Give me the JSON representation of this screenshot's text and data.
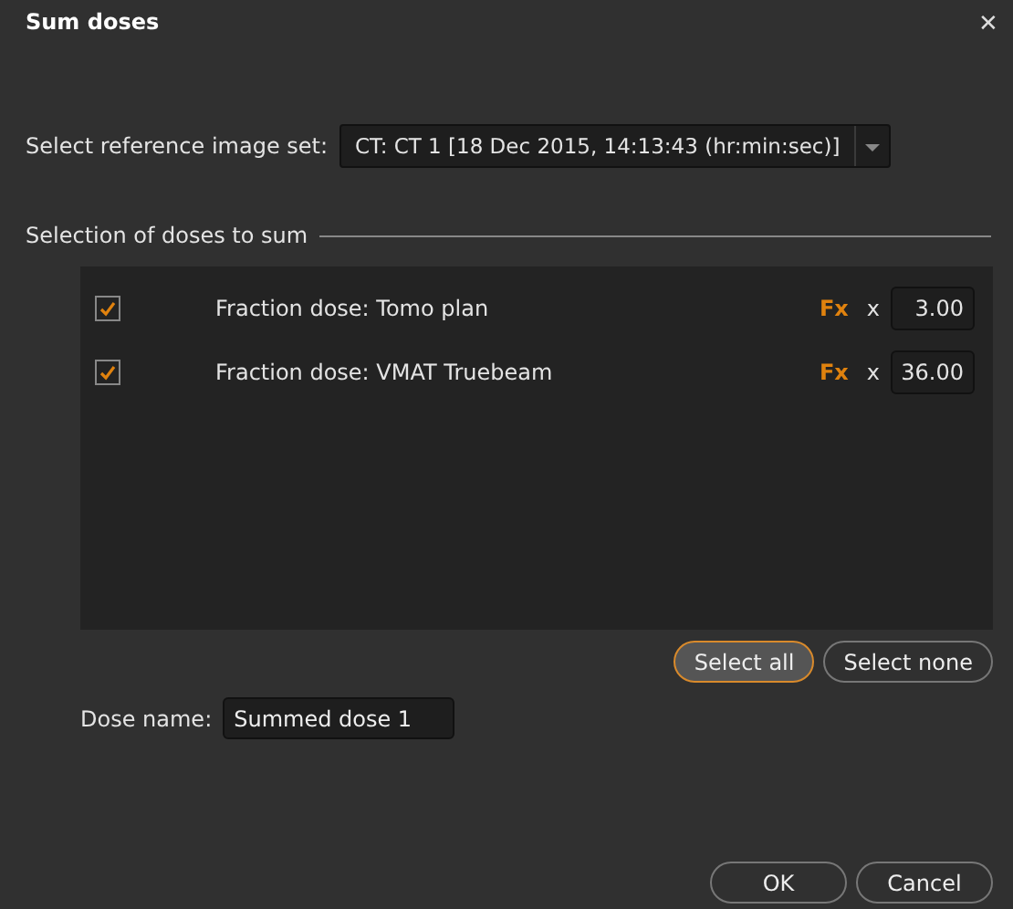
{
  "window": {
    "title": "Sum doses",
    "close": "✕"
  },
  "reference": {
    "label": "Select reference image set:",
    "value": "CT: CT 1 [18 Dec 2015, 14:13:43 (hr:min:sec)]"
  },
  "section": {
    "title": "Selection of doses to sum"
  },
  "doses": [
    {
      "name": "Fraction dose: Tomo plan",
      "checked": true,
      "fx": "Fx",
      "times": "x",
      "value": "3.00"
    },
    {
      "name": "Fraction dose: VMAT Truebeam",
      "checked": true,
      "fx": "Fx",
      "times": "x",
      "value": "36.00"
    }
  ],
  "selection_buttons": [
    {
      "label": "Select all",
      "focused": true
    },
    {
      "label": "Select none",
      "focused": false
    }
  ],
  "dose_name": {
    "label": "Dose name:",
    "value": "Summed dose 1"
  },
  "dialog_buttons": [
    {
      "label": "OK"
    },
    {
      "label": "Cancel"
    }
  ]
}
